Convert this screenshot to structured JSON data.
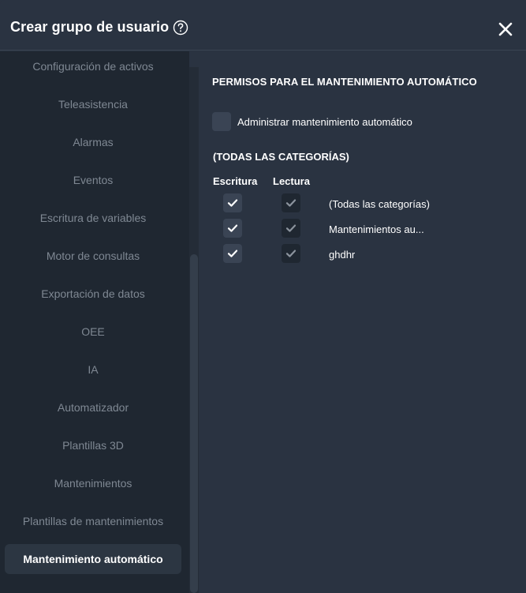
{
  "header": {
    "title": "Crear grupo de usuario",
    "help_icon": "question-circle-icon",
    "close_icon": "close-icon"
  },
  "sidebar": {
    "items": [
      {
        "label": "Configuración de activos",
        "active": false
      },
      {
        "label": "Teleasistencia",
        "active": false
      },
      {
        "label": "Alarmas",
        "active": false
      },
      {
        "label": "Eventos",
        "active": false
      },
      {
        "label": "Escritura de variables",
        "active": false
      },
      {
        "label": "Motor de consultas",
        "active": false
      },
      {
        "label": "Exportación de datos",
        "active": false
      },
      {
        "label": "OEE",
        "active": false
      },
      {
        "label": "IA",
        "active": false
      },
      {
        "label": "Automatizador",
        "active": false
      },
      {
        "label": "Plantillas 3D",
        "active": false
      },
      {
        "label": "Mantenimientos",
        "active": false
      },
      {
        "label": "Plantillas de mantenimientos",
        "active": false
      },
      {
        "label": "Mantenimiento automático",
        "active": true
      }
    ]
  },
  "main": {
    "section_title": "PERMISOS PARA EL MANTENIMIENTO AUTOMÁTICO",
    "admin": {
      "label": "Administrar mantenimiento automático",
      "checked": false
    },
    "categories_title": "(TODAS LAS CATEGORÍAS)",
    "columns": {
      "write": "Escritura",
      "read": "Lectura"
    },
    "rows": [
      {
        "label": "(Todas las categorías)",
        "write": true,
        "read": true
      },
      {
        "label": "Mantenimientos au...",
        "write": true,
        "read": true
      },
      {
        "label": "ghdhr",
        "write": true,
        "read": true
      }
    ]
  },
  "colors": {
    "background": "#2a3341",
    "sidebar": "#1f2731",
    "checkbox": "#3a4454",
    "text": "#ffffff",
    "muted_text": "#7f8893"
  }
}
